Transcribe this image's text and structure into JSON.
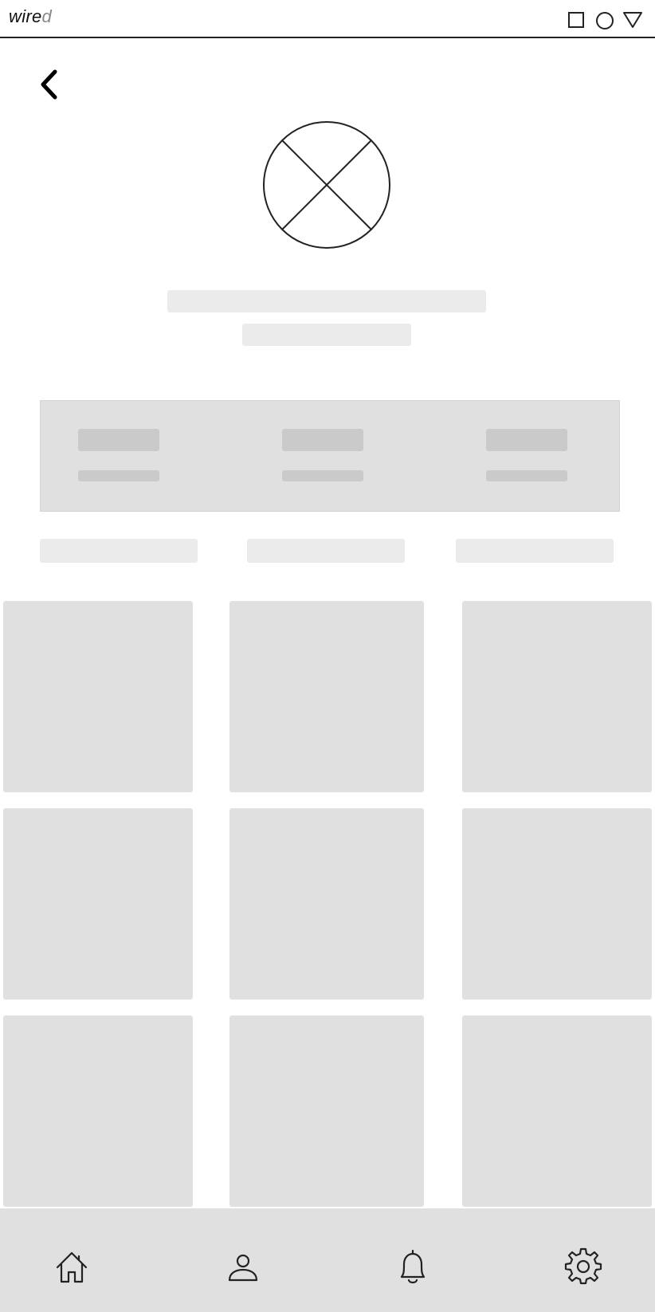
{
  "status_bar": {
    "brand_main": "wire",
    "brand_suffix": "d",
    "icons": [
      "square-icon",
      "circle-icon",
      "triangle-icon"
    ]
  },
  "header": {
    "back_icon": "chevron-left-icon"
  },
  "profile": {
    "avatar_icon": "image-placeholder-icon",
    "name": "",
    "subtitle": ""
  },
  "stats": [
    {
      "value": "",
      "label": ""
    },
    {
      "value": "",
      "label": ""
    },
    {
      "value": "",
      "label": ""
    }
  ],
  "tabs": [
    {
      "label": ""
    },
    {
      "label": ""
    },
    {
      "label": ""
    }
  ],
  "grid": {
    "rows": 3,
    "columns": 3
  },
  "bottom_nav": [
    {
      "icon": "home-icon"
    },
    {
      "icon": "user-icon"
    },
    {
      "icon": "bell-icon"
    },
    {
      "icon": "gear-icon"
    }
  ],
  "colors": {
    "placeholder_light": "#ebebeb",
    "panel": "#e0e0e0",
    "placeholder_dark": "#cacaca",
    "stroke": "#222222"
  }
}
